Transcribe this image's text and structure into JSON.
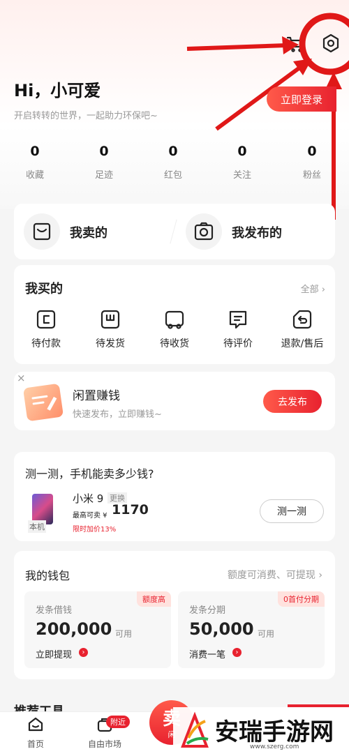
{
  "header": {
    "greeting": "Hi，小可爱",
    "subtitle": "开启转转的世界，一起助力环保吧~",
    "login_button": "立即登录",
    "cart_icon": "cart-icon",
    "settings_icon": "settings-icon"
  },
  "stats": [
    {
      "value": "0",
      "label": "收藏"
    },
    {
      "value": "0",
      "label": "足迹"
    },
    {
      "value": "0",
      "label": "红包"
    },
    {
      "value": "0",
      "label": "关注"
    },
    {
      "value": "0",
      "label": "粉丝"
    }
  ],
  "sell_card": {
    "my_sold": "我卖的",
    "my_published": "我发布的"
  },
  "orders": {
    "title": "我买的",
    "all_link": "全部",
    "items": [
      {
        "label": "待付款",
        "icon": "pending-payment-icon"
      },
      {
        "label": "待发货",
        "icon": "pending-shipment-icon"
      },
      {
        "label": "待收货",
        "icon": "pending-receipt-icon"
      },
      {
        "label": "待评价",
        "icon": "pending-review-icon"
      },
      {
        "label": "退款/售后",
        "icon": "refund-icon"
      }
    ]
  },
  "idle_banner": {
    "title": "闲置赚钱",
    "subtitle": "快速发布，立即赚钱~",
    "button": "去发布",
    "close": "×"
  },
  "phone_estimate": {
    "title": "测一测，手机能卖多少钱?",
    "model": "小米 9",
    "change": "更换",
    "price_prefix": "最高可卖 ¥",
    "price": "1170",
    "promo": "限时加价13%",
    "device_tag": "本机",
    "button": "测一测"
  },
  "wallet": {
    "title": "我的钱包",
    "subtitle": "额度可消费、可提现",
    "cards": [
      {
        "title": "发条借钱",
        "badge": "额度高",
        "amount": "200,000",
        "unit": "可用",
        "action": "立即提现"
      },
      {
        "title": "发条分期",
        "badge": "0首付分期",
        "amount": "50,000",
        "unit": "可用",
        "action": "消费一笔"
      }
    ]
  },
  "recommend_title": "推荐工具",
  "bottom_nav": {
    "items": [
      {
        "label": "首页"
      },
      {
        "label": "自由市场",
        "badge": "附近"
      }
    ],
    "sell_button": "卖",
    "sell_sub": "闲"
  },
  "watermark": {
    "name": "安瑞手游网",
    "url": "www.szerg.com"
  },
  "colors": {
    "accent": "#e8222f",
    "annotation": "#e01818"
  }
}
